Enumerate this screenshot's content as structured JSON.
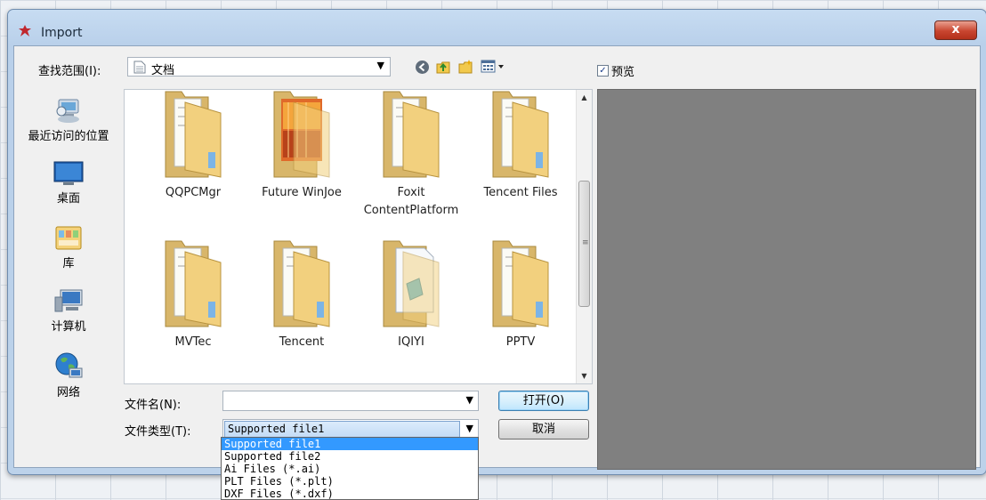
{
  "window": {
    "title": "Import",
    "close_label": "x"
  },
  "lookin": {
    "label": "查找范围(I):",
    "value": "文档"
  },
  "toolbar": {
    "icons": [
      "back-icon",
      "up-folder-icon",
      "new-folder-icon",
      "view-menu-icon"
    ]
  },
  "preview": {
    "label": "预览",
    "checked": true
  },
  "places": [
    {
      "label": "最近访问的位置",
      "icon": "recent-places-icon"
    },
    {
      "label": "桌面",
      "icon": "desktop-icon"
    },
    {
      "label": "库",
      "icon": "libraries-icon"
    },
    {
      "label": "计算机",
      "icon": "computer-icon"
    },
    {
      "label": "网络",
      "icon": "network-icon"
    }
  ],
  "files": [
    {
      "name": "QQPCMgr",
      "type": "folder"
    },
    {
      "name": "Future WinJoe",
      "type": "folder-image"
    },
    {
      "name": "Foxit ContentPlatform",
      "type": "folder"
    },
    {
      "name": "Tencent Files",
      "type": "folder"
    },
    {
      "name": "MVTec",
      "type": "folder"
    },
    {
      "name": "Tencent",
      "type": "folder"
    },
    {
      "name": "IQIYI",
      "type": "folder-file"
    },
    {
      "name": "PPTV",
      "type": "folder"
    }
  ],
  "filename": {
    "label": "文件名(N):",
    "value": ""
  },
  "filetype": {
    "label": "文件类型(T):",
    "value": "Supported file1",
    "options": [
      "Supported file1",
      "Supported file2",
      "Ai Files (*.ai)",
      "PLT Files (*.plt)",
      "DXF Files (*.dxf)"
    ]
  },
  "buttons": {
    "open": "打开(O)",
    "cancel": "取消"
  },
  "colors": {
    "selection": "#3399ff",
    "preview_bg": "#808080",
    "close_button": "#c8452f"
  }
}
